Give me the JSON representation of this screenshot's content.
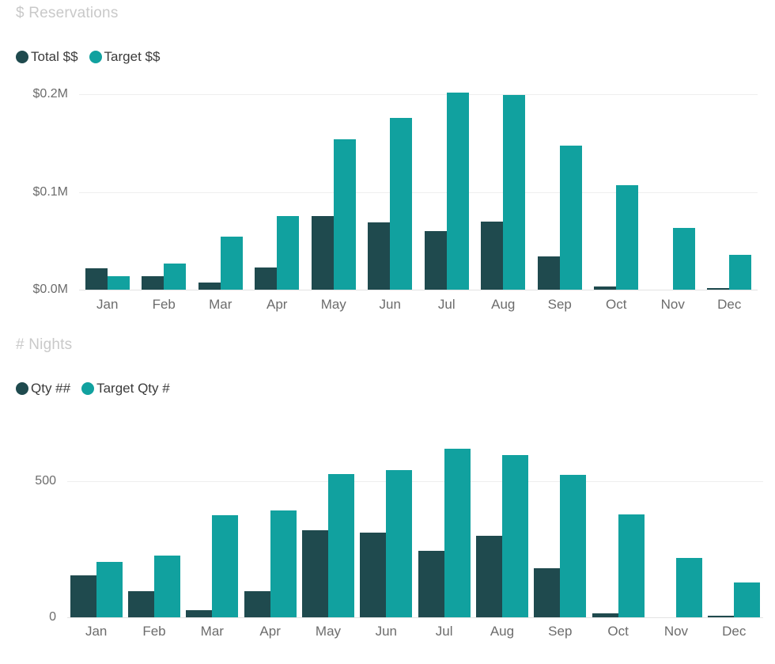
{
  "colors": {
    "actual": "#1f4a4e",
    "target": "#11a19f",
    "title": "#c9c9c9",
    "tick": "#6c6c6c",
    "grid": "#eeeeee",
    "background": "#ffffff"
  },
  "panels": [
    {
      "id": "money",
      "title": "$ Reservations",
      "legend": [
        {
          "label": "Total $$",
          "color": "#1f4a4e",
          "icon": "legend-dot-icon"
        },
        {
          "label": "Target $$",
          "color": "#11a19f",
          "icon": "legend-dot-icon"
        }
      ]
    },
    {
      "id": "nights",
      "title": "# Nights",
      "legend": [
        {
          "label": "Qty ##",
          "color": "#1f4a4e",
          "icon": "legend-dot-icon"
        },
        {
          "label": "Target Qty #",
          "color": "#11a19f",
          "icon": "legend-dot-icon"
        }
      ]
    }
  ],
  "chart_data": [
    {
      "type": "bar",
      "title": "$ Reservations",
      "xlabel": "",
      "ylabel": "",
      "categories": [
        "Jan",
        "Feb",
        "Mar",
        "Apr",
        "May",
        "Jun",
        "Jul",
        "Aug",
        "Sep",
        "Oct",
        "Nov",
        "Dec"
      ],
      "ylim": [
        0,
        200000
      ],
      "yticks": [
        0,
        100000,
        200000
      ],
      "ytick_labels": [
        "$0.0M",
        "$0.1M",
        "$0.2M"
      ],
      "grid": true,
      "legend_position": "top-left",
      "series": [
        {
          "name": "Total $$",
          "color": "#1f4a4e",
          "values": [
            22000,
            14000,
            7000,
            23000,
            75000,
            69000,
            60000,
            70000,
            34000,
            3000,
            0,
            1000
          ]
        },
        {
          "name": "Target $$",
          "color": "#11a19f",
          "values": [
            14000,
            27000,
            54000,
            75000,
            154000,
            176000,
            202000,
            199000,
            147000,
            107000,
            63000,
            36000
          ]
        }
      ]
    },
    {
      "type": "bar",
      "title": "# Nights",
      "xlabel": "",
      "ylabel": "",
      "categories": [
        "Jan",
        "Feb",
        "Mar",
        "Apr",
        "May",
        "Jun",
        "Jul",
        "Aug",
        "Sep",
        "Oct",
        "Nov",
        "Dec"
      ],
      "ylim": [
        0,
        640
      ],
      "yticks": [
        0,
        500
      ],
      "ytick_labels": [
        "0",
        "500"
      ],
      "grid": true,
      "legend_position": "top-left",
      "series": [
        {
          "name": "Qty ##",
          "color": "#1f4a4e",
          "values": [
            155,
            95,
            25,
            95,
            320,
            310,
            245,
            300,
            180,
            15,
            0,
            5
          ]
        },
        {
          "name": "Target Qty #",
          "color": "#11a19f",
          "values": [
            205,
            228,
            375,
            392,
            528,
            540,
            620,
            597,
            523,
            378,
            218,
            128
          ]
        }
      ]
    }
  ]
}
